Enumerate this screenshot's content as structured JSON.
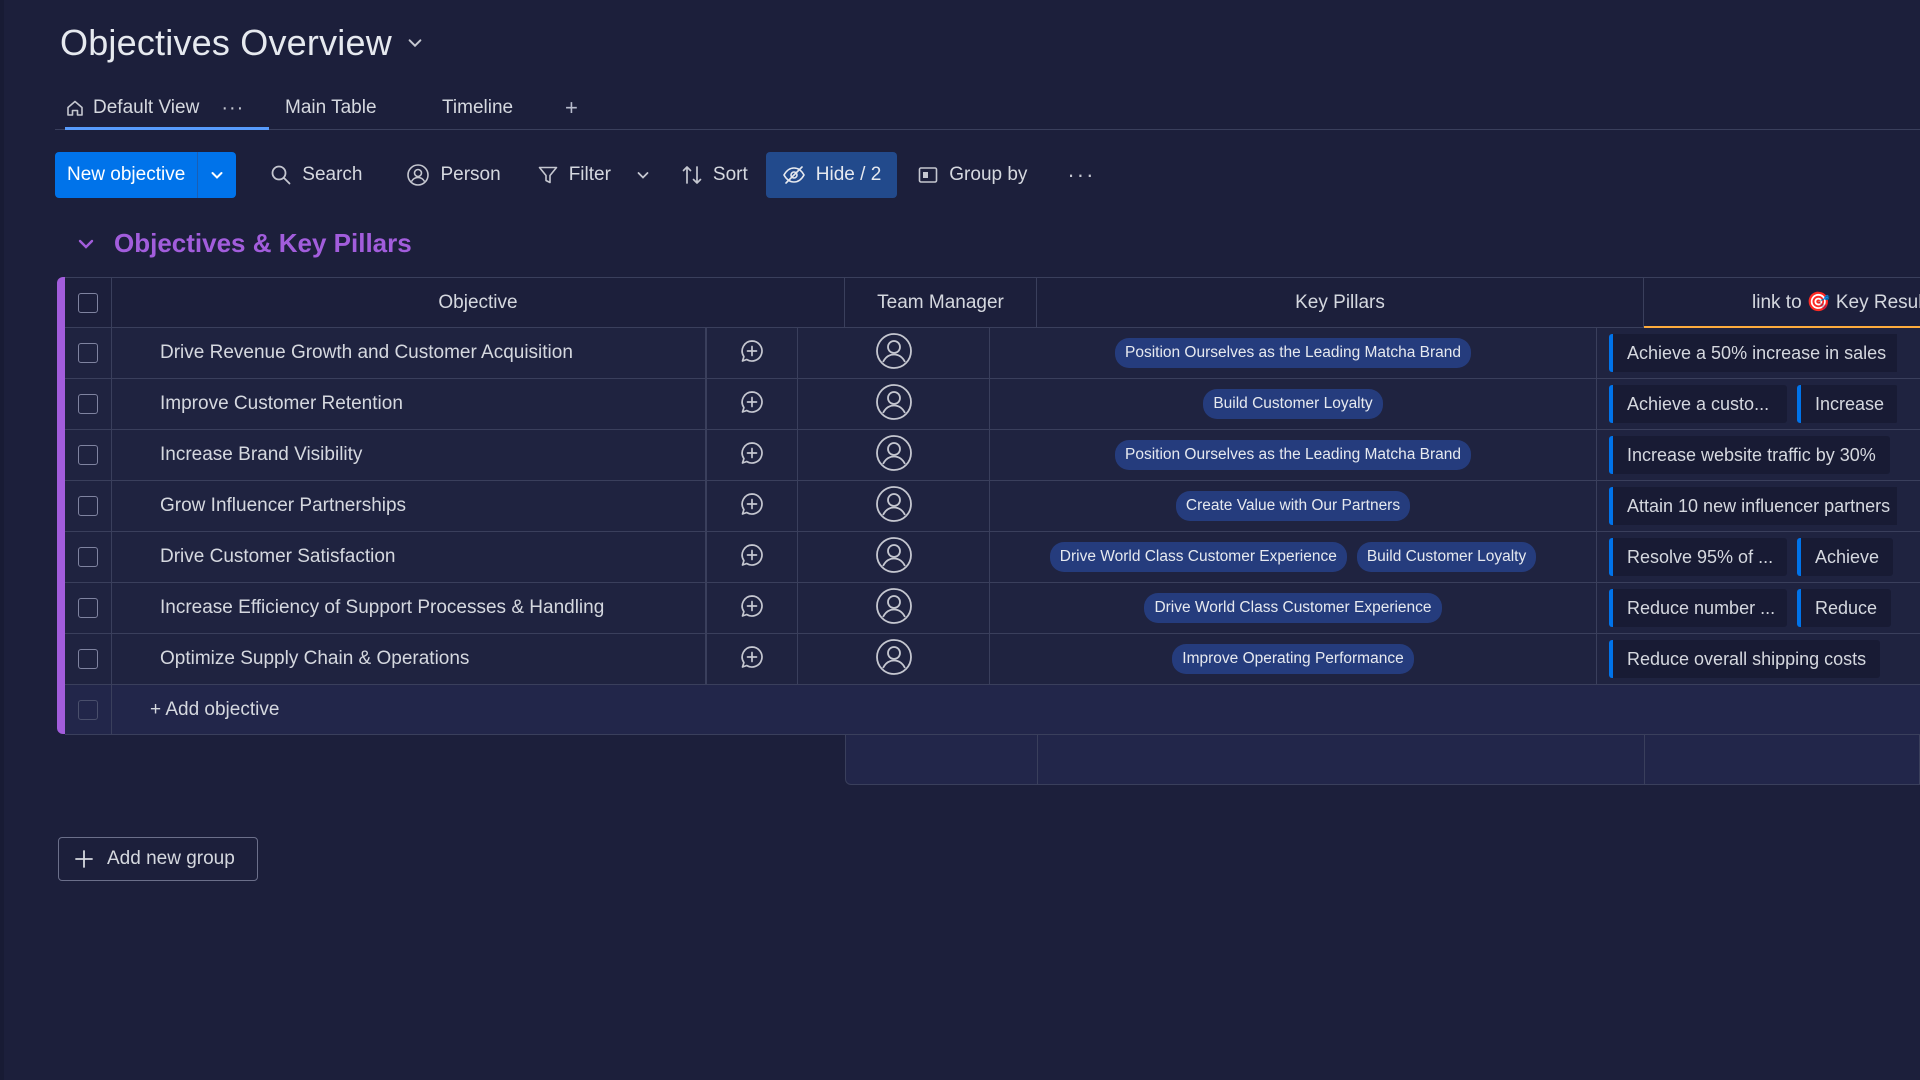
{
  "header": {
    "title": "Objectives Overview"
  },
  "tabs": [
    {
      "label": "Default View",
      "active": true
    },
    {
      "label": "Main Table"
    },
    {
      "label": "Timeline"
    }
  ],
  "toolbar": {
    "new_label": "New objective",
    "search_label": "Search",
    "person_label": "Person",
    "filter_label": "Filter",
    "sort_label": "Sort",
    "hide_label": "Hide / 2",
    "groupby_label": "Group by"
  },
  "group": {
    "title": "Objectives & Key Pillars",
    "color": "#a25ddc",
    "columns": {
      "objective": "Objective",
      "manager": "Team Manager",
      "pillars": "Key Pillars",
      "link": "link to 🎯 Key Results"
    },
    "rows": [
      {
        "objective": "Drive Revenue Growth and Customer Acquisition",
        "pillars": [
          "Position Ourselves as the Leading Matcha Brand"
        ],
        "links": [
          "Achieve a 50% increase in sales"
        ]
      },
      {
        "objective": "Improve Customer Retention",
        "pillars": [
          "Build Customer Loyalty"
        ],
        "links": [
          "Achieve a custo...",
          "Increase"
        ]
      },
      {
        "objective": "Increase Brand Visibility",
        "pillars": [
          "Position Ourselves as the Leading Matcha Brand"
        ],
        "links": [
          "Increase website traffic by 30%"
        ]
      },
      {
        "objective": "Grow Influencer Partnerships",
        "pillars": [
          "Create Value with Our Partners"
        ],
        "links": [
          "Attain 10 new influencer partners"
        ]
      },
      {
        "objective": "Drive Customer Satisfaction",
        "pillars": [
          "Drive World Class Customer Experience",
          "Build Customer Loyalty"
        ],
        "links": [
          "Resolve 95% of ...",
          "Achieve"
        ]
      },
      {
        "objective": "Increase Efficiency of Support Processes & Handling",
        "pillars": [
          "Drive World Class Customer Experience"
        ],
        "links": [
          "Reduce number ...",
          "Reduce"
        ]
      },
      {
        "objective": "Optimize Supply Chain & Operations",
        "pillars": [
          "Improve Operating Performance"
        ],
        "links": [
          "Reduce overall shipping costs"
        ]
      }
    ],
    "add_label": "+ Add objective"
  },
  "add_group_label": "Add new group",
  "colors": {
    "accent": "#0073ea",
    "pill": "#253c7d",
    "background": "#1c1f3b"
  },
  "icons": [
    "chevron-down-icon",
    "home-icon",
    "search-icon",
    "person-icon",
    "filter-icon",
    "sort-icon",
    "eye-off-icon",
    "group-by-icon",
    "add-update-icon",
    "avatar-icon",
    "plus-icon"
  ]
}
